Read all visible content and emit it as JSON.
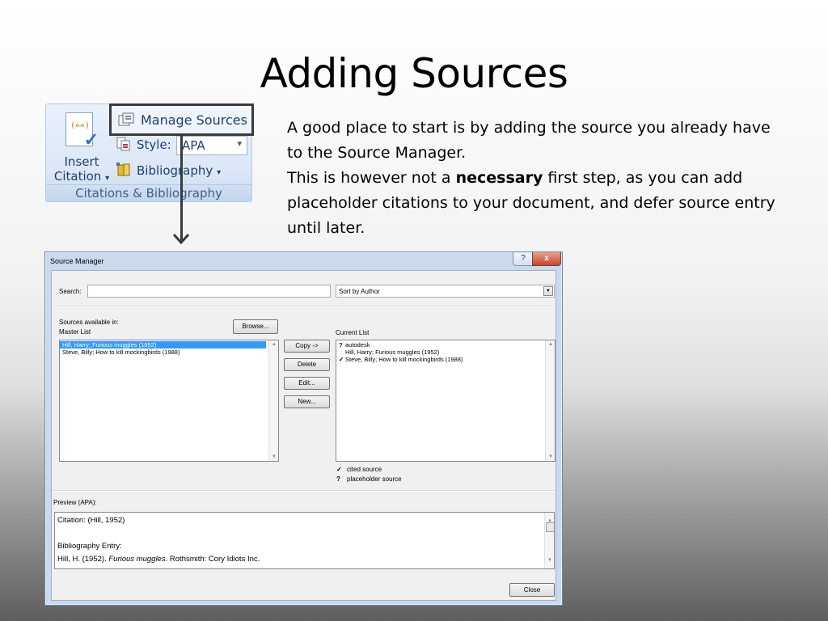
{
  "slide": {
    "title": "Adding Sources",
    "para1": "A good place to start is by adding the source you already have to the Source Manager.",
    "para2_pre": "This is however not a ",
    "para2_bold": "necessary",
    "para2_post": " first step, as you can add placeholder citations to your document, and defer source entry until later."
  },
  "ribbon": {
    "insert_citation_line1": "Insert",
    "insert_citation_line2": "Citation",
    "dropdown_glyph": "▾",
    "manage_sources": "Manage Sources",
    "style_label": "Style:",
    "style_value": "APA",
    "bibliography": "Bibliography",
    "group_label": "Citations & Bibliography"
  },
  "dialog": {
    "title": "Source Manager",
    "help_glyph": "?",
    "close_glyph": "x",
    "search_label": "Search:",
    "search_value": "",
    "sort_value": "Sort by Author",
    "sources_available_label": "Sources available in:",
    "master_list_label": "Master List",
    "browse_button": "Browse...",
    "current_list_label": "Current List",
    "master_list": [
      "Hill, Harry; Furious muggles (1952)",
      "Steve, Billy; How to kill mockingbirds (1988)"
    ],
    "current_list": [
      {
        "mark": "?",
        "text": "autodesk"
      },
      {
        "mark": "",
        "text": "Hill, Harry; Furious muggles (1952)"
      },
      {
        "mark": "✓",
        "text": "Steve, Billy; How to kill mockingbirds (1988)"
      }
    ],
    "buttons": {
      "copy": "Copy ->",
      "delete": "Delete",
      "edit": "Edit...",
      "new": "New..."
    },
    "legend": [
      {
        "mark": "✓",
        "text": "cited source"
      },
      {
        "mark": "?",
        "text": "placeholder source"
      }
    ],
    "preview_label": "Preview (APA):",
    "preview": {
      "citation": "Citation: (Hill, 1952)",
      "bib_heading": "Bibliography Entry:",
      "bib_pre": "Hill, H. (1952). ",
      "bib_italic": "Furious muggles",
      "bib_post": ". Rothsmith: Cory Idiots Inc."
    },
    "close_button": "Close"
  }
}
